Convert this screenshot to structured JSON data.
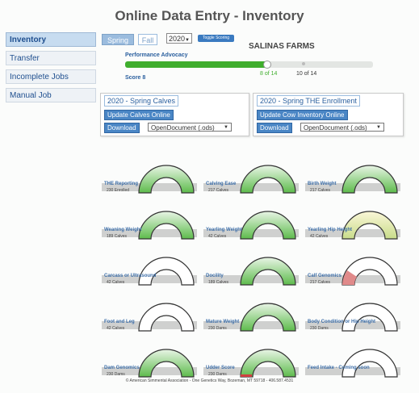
{
  "header": {
    "title": "Online Data Entry - Inventory"
  },
  "sidebar": {
    "items": [
      {
        "label": "Inventory",
        "active": true
      },
      {
        "label": "Transfer"
      },
      {
        "label": "Incomplete Jobs"
      },
      {
        "label": "Manual Job"
      }
    ]
  },
  "season": {
    "spring": "Spring",
    "fall": "Fall",
    "year": "2020",
    "toggle": "Toggle Scoring"
  },
  "farm": "SALINAS FARMS",
  "performance": {
    "label": "Performance Advocacy",
    "score": "Score 8",
    "progress_a": "8 of 14",
    "progress_b": "10 of 14",
    "fill_fraction": 0.57,
    "marker_b_fraction": 0.72
  },
  "panels": [
    {
      "title": "2020 - Spring Calves",
      "button": "Update Calves Online",
      "download": "Download",
      "format": "OpenDocument (.ods)"
    },
    {
      "title": "2020 - Spring THE Enrollment",
      "button": "Update Cow Inventory Online",
      "download": "Download",
      "format": "OpenDocument (.ods)"
    }
  ],
  "gauges": [
    {
      "label": "THE Reporting",
      "sub": "230 Enrolled",
      "state": "green"
    },
    {
      "label": "Calving Ease",
      "sub": "217 Calves",
      "state": "green"
    },
    {
      "label": "Birth Weight",
      "sub": "217 Calves",
      "state": "green"
    },
    {
      "label": "Weaning Weight",
      "sub": "189 Calves",
      "state": "green"
    },
    {
      "label": "Yearling Weight",
      "sub": "42 Calves",
      "state": "green"
    },
    {
      "label": "Yearling Hip Height",
      "sub": "42 Calves",
      "state": "yellow"
    },
    {
      "label": "Carcass or Ultrasound",
      "sub": "42 Calves",
      "state": "empty"
    },
    {
      "label": "Docility",
      "sub": "189 Calves",
      "state": "green"
    },
    {
      "label": "Calf Genomics",
      "sub": "217 Calves",
      "state": "red"
    },
    {
      "label": "Foot and Leg",
      "sub": "42 Calves",
      "state": "empty"
    },
    {
      "label": "Mature Weight",
      "sub": "230 Dams",
      "state": "green"
    },
    {
      "label": "Body Condition or Hip Height",
      "sub": "230 Dams",
      "state": "empty"
    },
    {
      "label": "Dam Genomics",
      "sub": "230 Dams",
      "state": "green"
    },
    {
      "label": "Udder Score",
      "sub": "230 Dams",
      "state": "redtip"
    },
    {
      "label": "Feed Intake - Coming soon",
      "sub": "",
      "state": "empty"
    }
  ],
  "footer": "© American Simmental Association - One Genetics Way, Bozeman, MT 59718 - 406.587.4531"
}
